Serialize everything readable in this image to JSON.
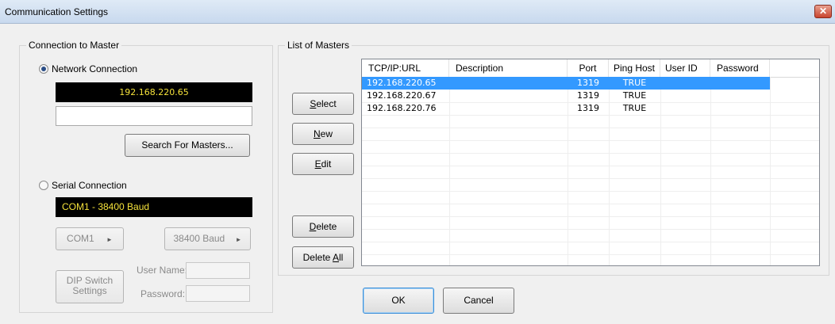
{
  "window": {
    "title": "Communication Settings",
    "close_glyph": "✕"
  },
  "connection": {
    "legend": "Connection to Master",
    "network_label": "Network Connection",
    "network_selected": true,
    "network_display": "192.168.220.65",
    "host_input_value": "",
    "search_button": "Search For Masters...",
    "serial_label": "Serial Connection",
    "serial_selected": false,
    "serial_display": "COM1 - 38400 Baud",
    "com_port": "COM1",
    "baud": "38400 Baud",
    "dip_switch_line1": "DIP Switch",
    "dip_switch_line2": "Settings",
    "user_name_label": "User Name:",
    "password_label": "Password:",
    "user_name_value": "",
    "password_value": ""
  },
  "masters": {
    "legend": "List of Masters",
    "buttons": {
      "select": {
        "key": "S",
        "rest": "elect"
      },
      "new": {
        "key": "N",
        "rest": "ew"
      },
      "edit": {
        "key": "E",
        "rest": "dit"
      },
      "delete": {
        "key": "D",
        "rest": "elete"
      },
      "delete_all": {
        "pre": "Delete ",
        "key": "A",
        "rest": "ll"
      }
    },
    "columns": [
      "TCP/IP:URL",
      "Description",
      "Port",
      "Ping Host",
      "User ID",
      "Password"
    ],
    "rows": [
      {
        "url": "192.168.220.65",
        "description": "",
        "port": "1319",
        "ping": "TRUE",
        "user_id": "",
        "password": "",
        "selected": true
      },
      {
        "url": "192.168.220.67",
        "description": "",
        "port": "1319",
        "ping": "TRUE",
        "user_id": "",
        "password": "",
        "selected": false
      },
      {
        "url": "192.168.220.76",
        "description": "",
        "port": "1319",
        "ping": "TRUE",
        "user_id": "",
        "password": "",
        "selected": false
      }
    ]
  },
  "footer": {
    "ok": "OK",
    "cancel": "Cancel"
  },
  "colors": {
    "selection": "#3399ff",
    "display_text": "#f5e23a",
    "display_bg": "#000000"
  }
}
